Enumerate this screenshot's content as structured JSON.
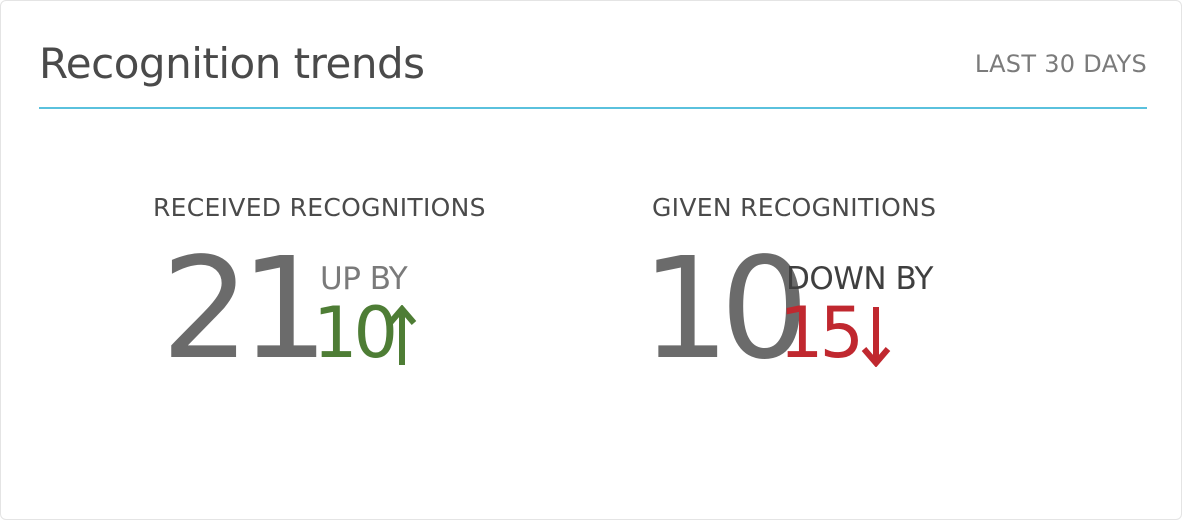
{
  "card": {
    "title": "Recognition trends",
    "period": "LAST 30 DAYS"
  },
  "metrics": [
    {
      "label": "RECEIVED RECOGNITIONS",
      "value": "21",
      "change_label": "UP BY",
      "change_value": "10",
      "direction_icon": "arrow-up-icon",
      "color": "#4e7d35"
    },
    {
      "label": "GIVEN RECOGNITIONS",
      "value": "10",
      "change_label": "DOWN BY",
      "change_value": "15",
      "direction_icon": "arrow-down-icon",
      "color": "#c0282f"
    }
  ],
  "colors": {
    "accent_line": "#5ac1dd",
    "positive": "#4e7d35",
    "negative": "#c0282f"
  }
}
